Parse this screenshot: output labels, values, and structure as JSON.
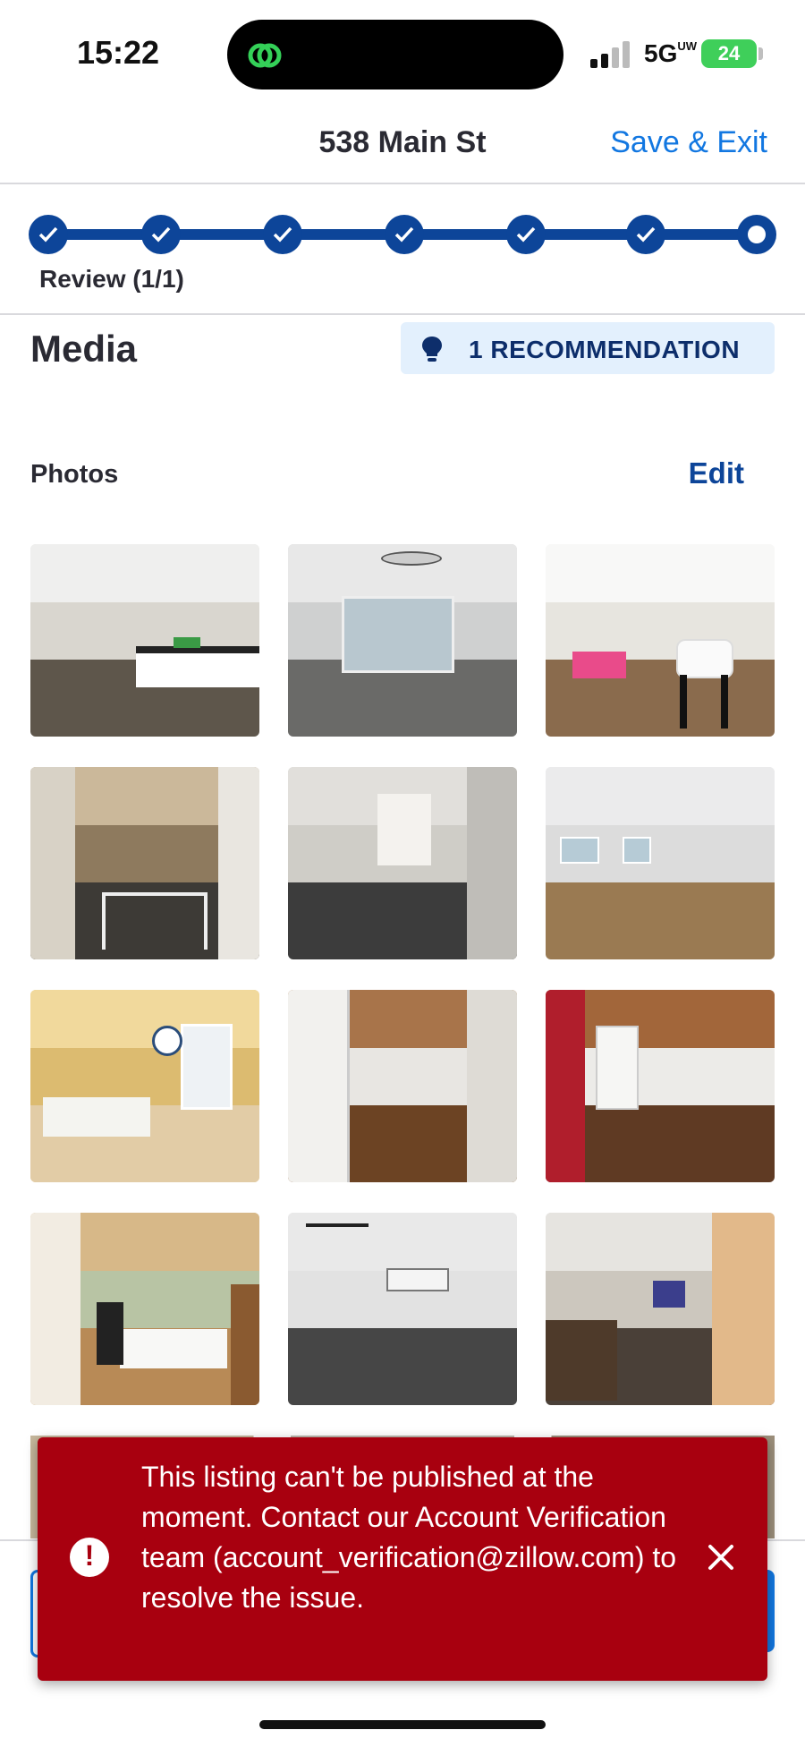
{
  "status_bar": {
    "time": "15:22",
    "network": "5G",
    "network_suffix": "UW",
    "battery": "24"
  },
  "header": {
    "title": "538 Main St",
    "save_exit": "Save & Exit"
  },
  "stepper": {
    "steps_total": 7,
    "steps_completed": 6,
    "current_label": "Review (1/1)"
  },
  "media": {
    "title": "Media",
    "recommendation": "1 RECOMMENDATION",
    "photos_label": "Photos",
    "edit": "Edit"
  },
  "photos": [
    "kitchen-open-plan",
    "living-room-slider-door",
    "kitchen-with-stools",
    "hallway-carpet",
    "hallway-to-room",
    "living-room-windows",
    "yellow-living-room",
    "bedroom-wood-ceiling",
    "entry-red-door",
    "bedroom-with-bed",
    "carpet-room-track-light",
    "kids-room"
  ],
  "toast": {
    "message": "This listing can't be published at the moment. Contact our Account Verification team (account_verification@zillow.com) to resolve the issue."
  },
  "colors": {
    "primary_blue": "#0d4599",
    "link_blue": "#1277e1",
    "error_red": "#a8000f",
    "badge_bg": "#e3f0fd"
  }
}
